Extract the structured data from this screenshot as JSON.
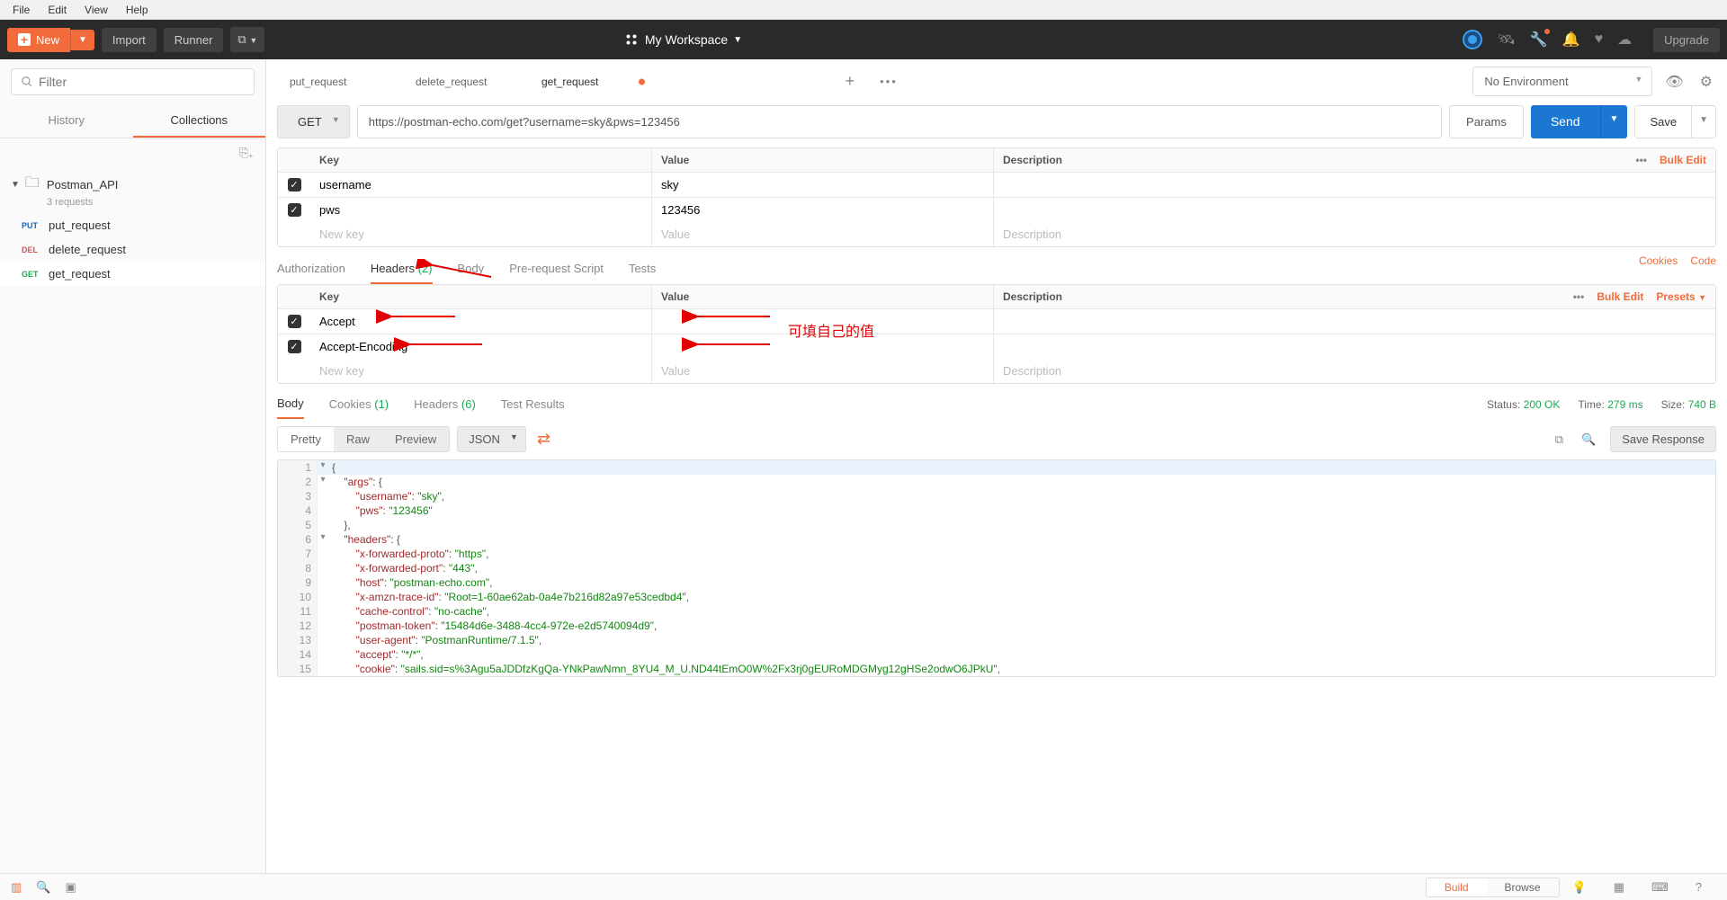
{
  "menubar": [
    "File",
    "Edit",
    "View",
    "Help"
  ],
  "toolbar": {
    "new": "New",
    "import": "Import",
    "runner": "Runner",
    "workspace": "My Workspace",
    "upgrade": "Upgrade"
  },
  "sidebar": {
    "filter_placeholder": "Filter",
    "tabs": {
      "history": "History",
      "collections": "Collections"
    },
    "collection": {
      "name": "Postman_API",
      "sub": "3 requests"
    },
    "requests": [
      {
        "method": "PUT",
        "name": "put_request",
        "cls": "m-put"
      },
      {
        "method": "DEL",
        "name": "delete_request",
        "cls": "m-del"
      },
      {
        "method": "GET",
        "name": "get_request",
        "cls": "m-get"
      }
    ]
  },
  "tabs": [
    {
      "label": "put_request",
      "dirty": false
    },
    {
      "label": "delete_request",
      "dirty": false
    },
    {
      "label": "get_request",
      "dirty": true
    }
  ],
  "env": {
    "none": "No Environment"
  },
  "request": {
    "method": "GET",
    "url": "https://postman-echo.com/get?username=sky&pws=123456",
    "params": "Params",
    "send": "Send",
    "save": "Save"
  },
  "params_table": {
    "head": {
      "key": "Key",
      "value": "Value",
      "desc": "Description",
      "bulk": "Bulk Edit"
    },
    "rows": [
      {
        "key": "username",
        "value": "sky"
      },
      {
        "key": "pws",
        "value": "123456"
      }
    ],
    "placeholders": {
      "key": "New key",
      "value": "Value",
      "desc": "Description"
    }
  },
  "req_tabs": {
    "auth": "Authorization",
    "headers": "Headers",
    "headers_cnt": "(2)",
    "body": "Body",
    "prereq": "Pre-request Script",
    "tests": "Tests",
    "cookies": "Cookies",
    "code": "Code"
  },
  "headers_table": {
    "head": {
      "key": "Key",
      "value": "Value",
      "desc": "Description",
      "bulk": "Bulk Edit",
      "presets": "Presets"
    },
    "rows": [
      {
        "key": "Accept",
        "value": ""
      },
      {
        "key": "Accept-Encoding",
        "value": ""
      }
    ]
  },
  "annotation": "可填自己的值",
  "resp_tabs": {
    "body": "Body",
    "cookies": "Cookies",
    "cookies_cnt": "(1)",
    "headers": "Headers",
    "headers_cnt": "(6)",
    "tests": "Test Results"
  },
  "resp_stat": {
    "status_lbl": "Status:",
    "status_val": "200 OK",
    "time_lbl": "Time:",
    "time_val": "279 ms",
    "size_lbl": "Size:",
    "size_val": "740 B"
  },
  "resp_toolbar": {
    "pretty": "Pretty",
    "raw": "Raw",
    "preview": "Preview",
    "format": "JSON",
    "save": "Save Response"
  },
  "json_lines": [
    {
      "n": 1,
      "fold": "▾",
      "html": "<span class='tk-p'>{</span>"
    },
    {
      "n": 2,
      "fold": "▾",
      "html": "    <span class='tk-k'>\"args\"</span><span class='tk-p'>: {</span>"
    },
    {
      "n": 3,
      "fold": "",
      "html": "        <span class='tk-k'>\"username\"</span><span class='tk-p'>: </span><span class='tk-s'>\"sky\"</span><span class='tk-p'>,</span>"
    },
    {
      "n": 4,
      "fold": "",
      "html": "        <span class='tk-k'>\"pws\"</span><span class='tk-p'>: </span><span class='tk-s'>\"123456\"</span>"
    },
    {
      "n": 5,
      "fold": "",
      "html": "    <span class='tk-p'>},</span>"
    },
    {
      "n": 6,
      "fold": "▾",
      "html": "    <span class='tk-k'>\"headers\"</span><span class='tk-p'>: {</span>"
    },
    {
      "n": 7,
      "fold": "",
      "html": "        <span class='tk-k'>\"x-forwarded-proto\"</span><span class='tk-p'>: </span><span class='tk-s'>\"https\"</span><span class='tk-p'>,</span>"
    },
    {
      "n": 8,
      "fold": "",
      "html": "        <span class='tk-k'>\"x-forwarded-port\"</span><span class='tk-p'>: </span><span class='tk-s'>\"443\"</span><span class='tk-p'>,</span>"
    },
    {
      "n": 9,
      "fold": "",
      "html": "        <span class='tk-k'>\"host\"</span><span class='tk-p'>: </span><span class='tk-s'>\"postman-echo.com\"</span><span class='tk-p'>,</span>"
    },
    {
      "n": 10,
      "fold": "",
      "html": "        <span class='tk-k'>\"x-amzn-trace-id\"</span><span class='tk-p'>: </span><span class='tk-s'>\"Root=1-60ae62ab-0a4e7b216d82a97e53cedbd4\"</span><span class='tk-p'>,</span>"
    },
    {
      "n": 11,
      "fold": "",
      "html": "        <span class='tk-k'>\"cache-control\"</span><span class='tk-p'>: </span><span class='tk-s'>\"no-cache\"</span><span class='tk-p'>,</span>"
    },
    {
      "n": 12,
      "fold": "",
      "html": "        <span class='tk-k'>\"postman-token\"</span><span class='tk-p'>: </span><span class='tk-s'>\"15484d6e-3488-4cc4-972e-e2d5740094d9\"</span><span class='tk-p'>,</span>"
    },
    {
      "n": 13,
      "fold": "",
      "html": "        <span class='tk-k'>\"user-agent\"</span><span class='tk-p'>: </span><span class='tk-s'>\"PostmanRuntime/7.1.5\"</span><span class='tk-p'>,</span>"
    },
    {
      "n": 14,
      "fold": "",
      "html": "        <span class='tk-k'>\"accept\"</span><span class='tk-p'>: </span><span class='tk-s'>\"*/*\"</span><span class='tk-p'>,</span>"
    },
    {
      "n": 15,
      "fold": "",
      "html": "        <span class='tk-k'>\"cookie\"</span><span class='tk-p'>: </span><span class='tk-s'>\"sails.sid=s%3Agu5aJDDfzKgQa-YNkPawNmn_8YU4_M_U.ND44tEmO0W%2Fx3rj0gEURoMDGMyg12gHSe2odwO6JPkU\"</span><span class='tk-p'>,</span>"
    }
  ],
  "bottom": {
    "build": "Build",
    "browse": "Browse"
  }
}
